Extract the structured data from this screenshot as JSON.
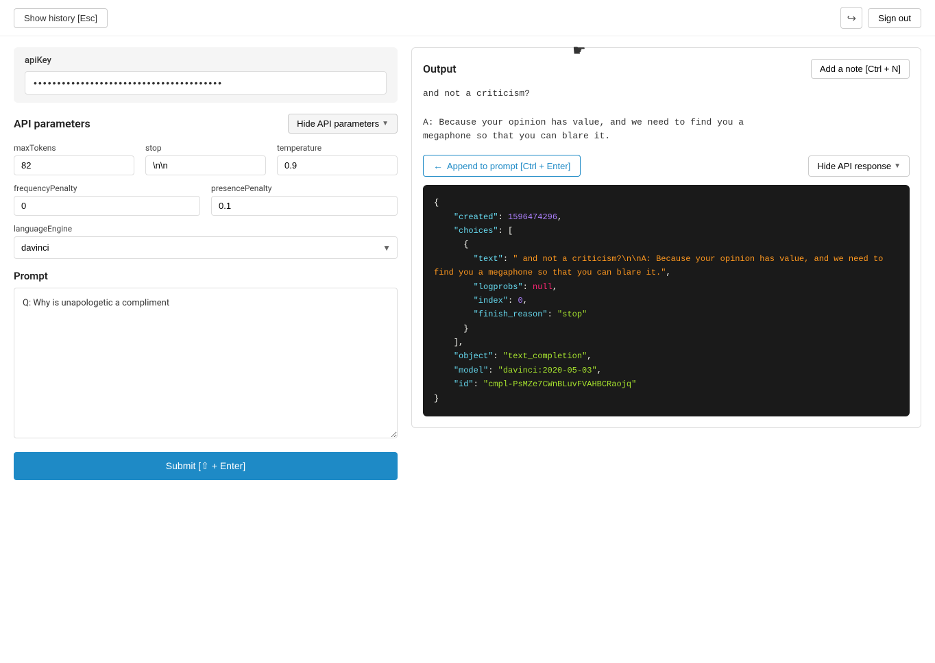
{
  "topBar": {
    "showHistoryLabel": "Show history [Esc]",
    "signOutLabel": "Sign out",
    "signOutIconSymbol": "↪"
  },
  "apiKey": {
    "label": "apiKey",
    "value": "••••••••••••••••••••••••••••••••••••••••"
  },
  "apiParams": {
    "title": "API parameters",
    "hideButtonLabel": "Hide API parameters",
    "fields": {
      "maxTokens": {
        "label": "maxTokens",
        "value": "82"
      },
      "stop": {
        "label": "stop",
        "value": "\\n\\n"
      },
      "temperature": {
        "label": "temperature",
        "value": "0.9"
      },
      "frequencyPenalty": {
        "label": "frequencyPenalty",
        "value": "0"
      },
      "presencePenalty": {
        "label": "presencePenalty",
        "value": "0.1"
      },
      "languageEngine": {
        "label": "languageEngine",
        "value": "davinci"
      }
    }
  },
  "prompt": {
    "label": "Prompt",
    "value": "Q: Why is unapologetic a compliment",
    "placeholder": ""
  },
  "submitButton": {
    "label": "Submit [⇧ + Enter]"
  },
  "output": {
    "title": "Output",
    "addNoteLabel": "Add a note [Ctrl + N]",
    "text": "and not a criticism?\n\nA: Because your opinion has value, and we need to find you a\nmegaphone so that you can blare it.",
    "appendButtonLabel": "Append to prompt [Ctrl + Enter]",
    "hideApiResponseLabel": "Hide API response",
    "jsonBlock": {
      "created": "1596474296",
      "text": "\" and not a criticism?\\n\\nA: Because your opinion has value, and we need to find you a megaphone so that you can blare it.\"",
      "logprobs": "null",
      "index": "0",
      "finish_reason": "\"stop\"",
      "object": "\"text_completion\"",
      "model": "\"davinci:2020-05-03\"",
      "id": "\"cmpl-PsMZe7CWnBLuvFVAHBCRaojq\""
    }
  }
}
